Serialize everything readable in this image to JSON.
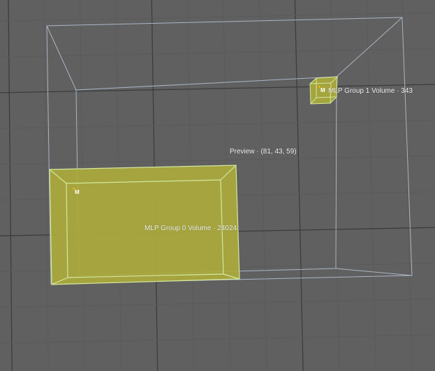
{
  "scene": {
    "preview_label": "Preview · (81, 43, 59)",
    "volumes": [
      {
        "label": "MLP Group 0 Volume · 24024",
        "icon": "M"
      },
      {
        "label": "MLP Group 1 Volume · 343",
        "icon": "M"
      }
    ]
  },
  "colors": {
    "background": "#606060",
    "volume_fill": "#abaa3c",
    "volume_edge": "#d4e8a0",
    "bounds_wire": "#b9c6d8"
  }
}
